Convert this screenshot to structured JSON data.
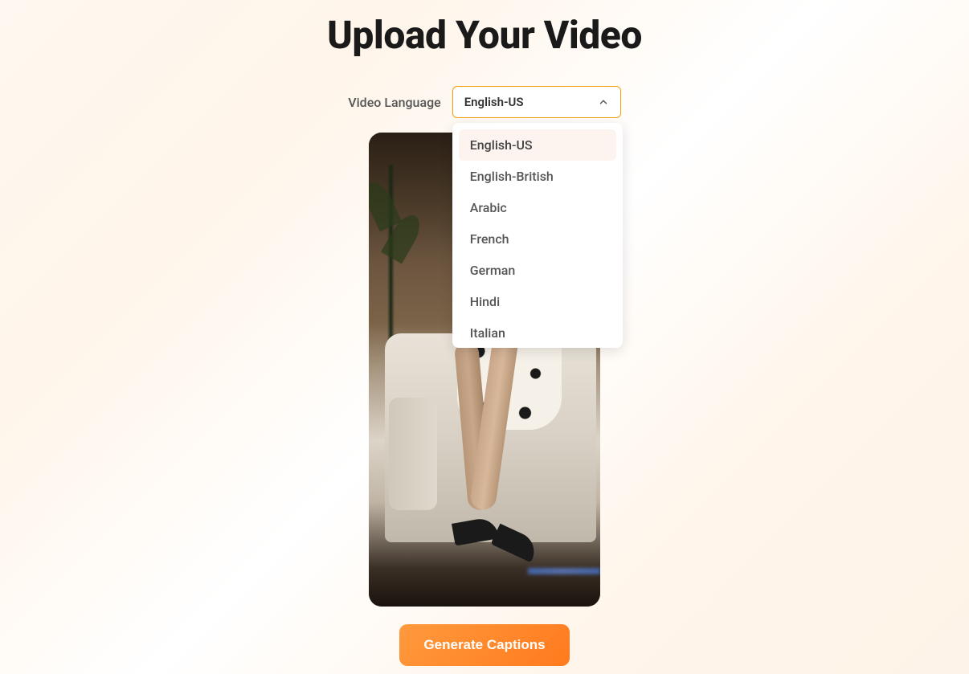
{
  "header": {
    "title": "Upload Your Video"
  },
  "language": {
    "label": "Video Language",
    "selected": "English-US",
    "options": [
      "English-US",
      "English-British",
      "Arabic",
      "French",
      "German",
      "Hindi",
      "Italian"
    ]
  },
  "actions": {
    "generate": "Generate Captions"
  }
}
